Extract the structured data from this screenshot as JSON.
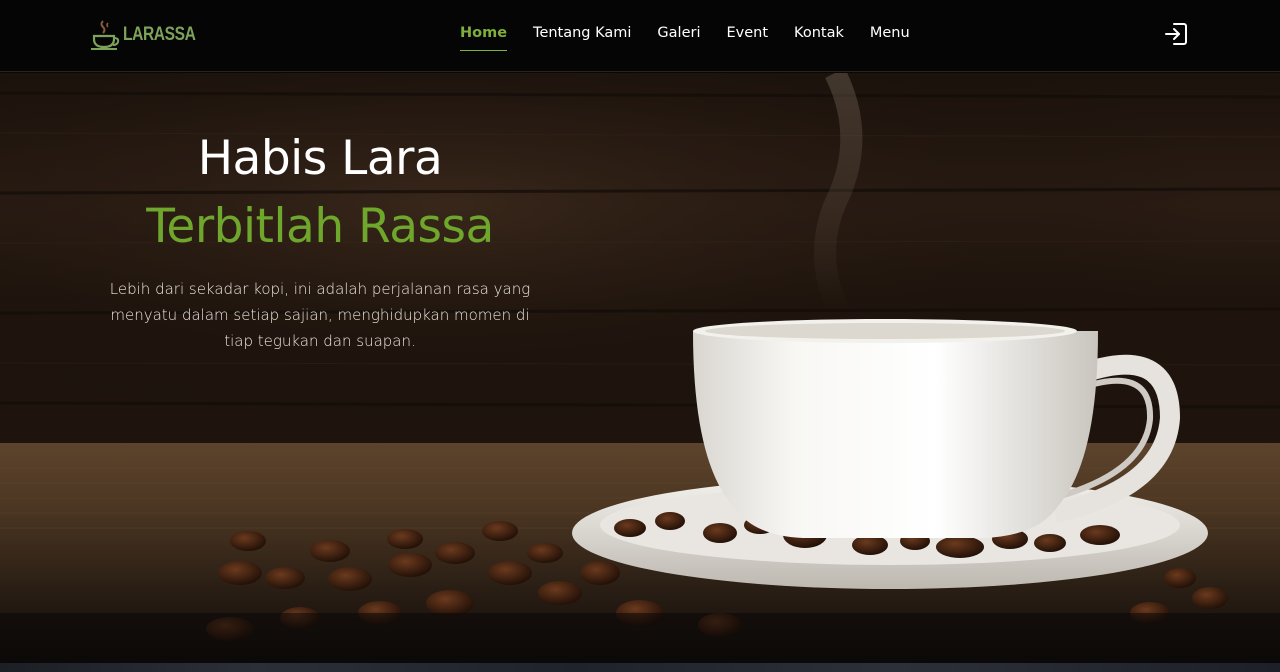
{
  "brand": {
    "name": "LARASSA",
    "accent": "#7fb03a"
  },
  "nav": {
    "items": [
      {
        "label": "Home",
        "active": true
      },
      {
        "label": "Tentang Kami",
        "active": false
      },
      {
        "label": "Galeri",
        "active": false
      },
      {
        "label": "Event",
        "active": false
      },
      {
        "label": "Kontak",
        "active": false
      },
      {
        "label": "Menu",
        "active": false
      }
    ],
    "login_icon": "login-icon"
  },
  "hero": {
    "title_line1": "Habis Lara",
    "title_line2": "Terbitlah Rassa",
    "description": "Lebih dari sekadar kopi, ini adalah perjalanan rasa yang menyatu dalam setiap sajian, menghidupkan momen di tiap tegukan dan suapan.",
    "title2_color": "#6fa62c"
  }
}
